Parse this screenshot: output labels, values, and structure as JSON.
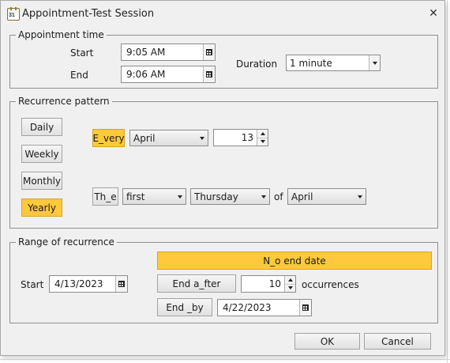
{
  "window": {
    "title": "Appointment-Test Session",
    "icon_text": "31"
  },
  "appointment_time": {
    "legend": "Appointment time",
    "start_label": "Start",
    "start_value": "9:05 AM",
    "end_label": "End",
    "end_value": "9:06 AM",
    "duration_label": "Duration",
    "duration_value": "1 minute"
  },
  "recurrence_pattern": {
    "legend": "Recurrence pattern",
    "frequency_buttons": [
      "Daily",
      "Weekly",
      "Monthly",
      "Yearly"
    ],
    "selected_frequency": "Yearly",
    "every_label": "E_very",
    "every_month": "April",
    "every_day": "13",
    "the_label": "Th_e",
    "the_ordinal": "first",
    "the_weekday": "Thursday",
    "of_label": "of",
    "the_month": "April"
  },
  "range": {
    "legend": "Range of recurrence",
    "start_label": "Start",
    "start_value": "4/13/2023",
    "no_end_label": "N_o end date",
    "end_after_label": "End a_fter",
    "occurrences_value": "10",
    "occurrences_label": "occurrences",
    "end_by_label": "End _by",
    "end_by_value": "4/22/2023"
  },
  "footer": {
    "ok_label": "OK",
    "cancel_label": "Cancel"
  },
  "colors": {
    "accent": "#ffc83d",
    "dialog_bg": "#f0f0f0",
    "border": "#8f8f8f"
  }
}
